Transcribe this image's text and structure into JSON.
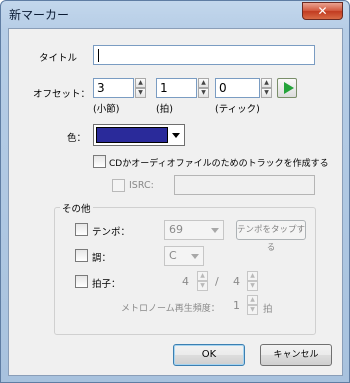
{
  "window": {
    "title": "新マーカー",
    "close_glyph": "✕"
  },
  "form": {
    "title_label": "タイトル",
    "title_value": "",
    "offset_label": "オフセット：",
    "offset": [
      {
        "value": "3",
        "caption": "(小節)"
      },
      {
        "value": "1",
        "caption": "(拍)"
      },
      {
        "value": "0",
        "caption": "(ティック)"
      }
    ],
    "color_label": "色：",
    "color_value": "#2a2a9a",
    "cd_track_label": "CDかオーディオファイルのためのトラックを作成する",
    "isrc_label": "ISRC:",
    "isrc_value": ""
  },
  "other": {
    "group_title": "その他",
    "tempo_label": "テンポ：",
    "tempo_value": "69",
    "tap_tempo_button": "テンポをタップする",
    "key_label": "調：",
    "key_value": "C",
    "time_sig_label": "拍子：",
    "time_sig_numerator": "4",
    "time_sig_slash": "/",
    "time_sig_denominator": "4",
    "metronome_label": "メトロノーム再生頻度：",
    "metronome_value": "1",
    "metronome_unit": "拍"
  },
  "buttons": {
    "ok": "OK",
    "cancel": "キャンセル"
  },
  "icons": {
    "spin_up": "▲",
    "spin_down": "▼",
    "play": "play-icon"
  }
}
